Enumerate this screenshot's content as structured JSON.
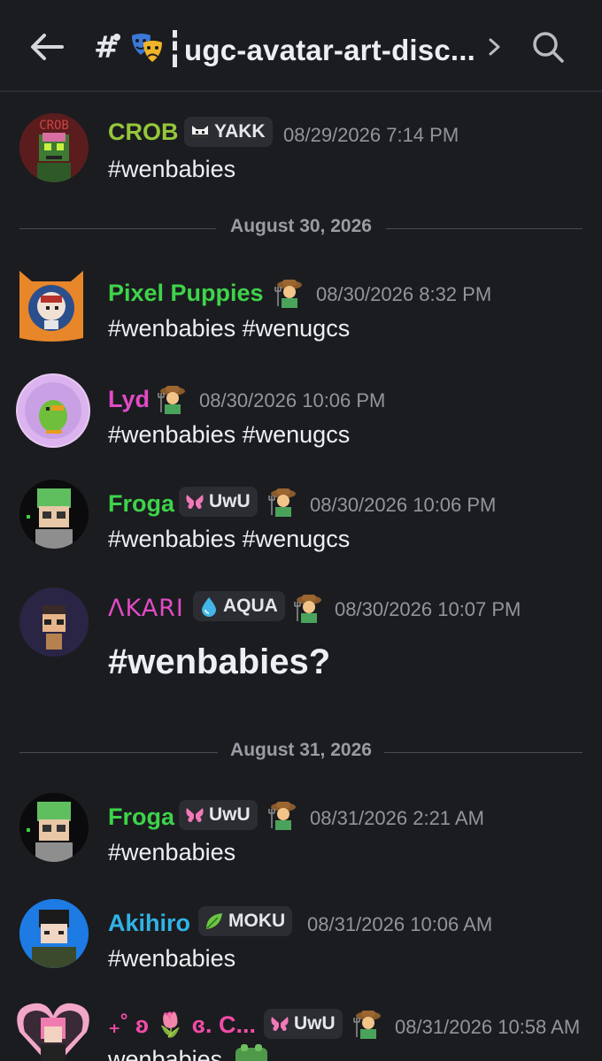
{
  "header": {
    "channel_name": "ugc-avatar-art-disc...",
    "channel_emoji": "theater-masks-icon"
  },
  "dividers": [
    "August 30, 2026",
    "August 31, 2026"
  ],
  "colors": {
    "crob": "#94c73a",
    "pixel": "#3ed34a",
    "lyd": "#e14bc4",
    "froga": "#3ed34a",
    "akari": "#e14bc4",
    "akihiro": "#2fb4e6",
    "last": "#f24ca6"
  },
  "messages": [
    {
      "username": "CROB",
      "tag": "YAKK",
      "tag_icon": "cat-icon",
      "farmer": false,
      "timestamp": "08/29/2026 7:14 PM",
      "text": "#wenbabies"
    },
    {
      "username": "Pixel Puppies",
      "tag": "",
      "farmer": true,
      "timestamp": "08/30/2026 8:32 PM",
      "text": "#wenbabies #wenugcs"
    },
    {
      "username": "Lyd",
      "tag": "",
      "farmer": true,
      "timestamp": "08/30/2026 10:06 PM",
      "text": "#wenbabies #wenugcs"
    },
    {
      "username": "Froga",
      "tag": "UwU",
      "tag_icon": "butterfly-icon",
      "farmer": true,
      "timestamp": "08/30/2026 10:06 PM",
      "text": "#wenbabies #wenugcs"
    },
    {
      "username": "ᐱKARI",
      "tag": "AQUA",
      "tag_icon": "droplet-icon",
      "farmer": true,
      "timestamp": "08/30/2026 10:07 PM",
      "text": "#wenbabies?"
    },
    {
      "username": "Froga",
      "tag": "UwU",
      "tag_icon": "butterfly-icon",
      "farmer": true,
      "timestamp": "08/31/2026 2:21 AM",
      "text": "#wenbabies"
    },
    {
      "username": "Akihiro",
      "tag": "MOKU",
      "tag_icon": "leaf-icon",
      "farmer": false,
      "timestamp": "08/31/2026 10:06 AM",
      "text": "#wenbabies"
    },
    {
      "username": "₊˚ ʚ 🌷 ɞ. C...",
      "tag": "UwU",
      "tag_icon": "butterfly-icon",
      "farmer": true,
      "timestamp": "08/31/2026 10:58 AM",
      "text": "wenbabies"
    }
  ]
}
